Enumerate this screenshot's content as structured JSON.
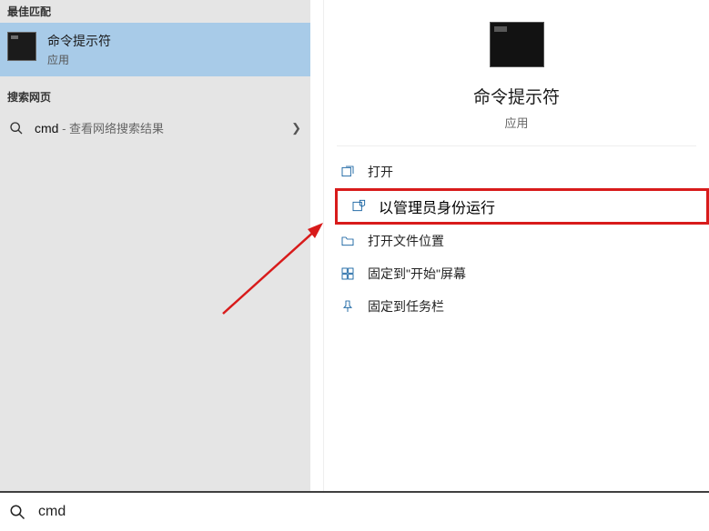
{
  "left": {
    "best_match_header": "最佳匹配",
    "result": {
      "title": "命令提示符",
      "subtitle": "应用"
    },
    "web_header": "搜索网页",
    "web": {
      "query": "cmd",
      "suffix": " - 查看网络搜索结果"
    }
  },
  "preview": {
    "title": "命令提示符",
    "subtitle": "应用",
    "actions": {
      "open": "打开",
      "run_as_admin": "以管理员身份运行",
      "open_file_location": "打开文件位置",
      "pin_to_start": "固定到\"开始\"屏幕",
      "pin_to_taskbar": "固定到任务栏"
    }
  },
  "search": {
    "value": "cmd"
  }
}
